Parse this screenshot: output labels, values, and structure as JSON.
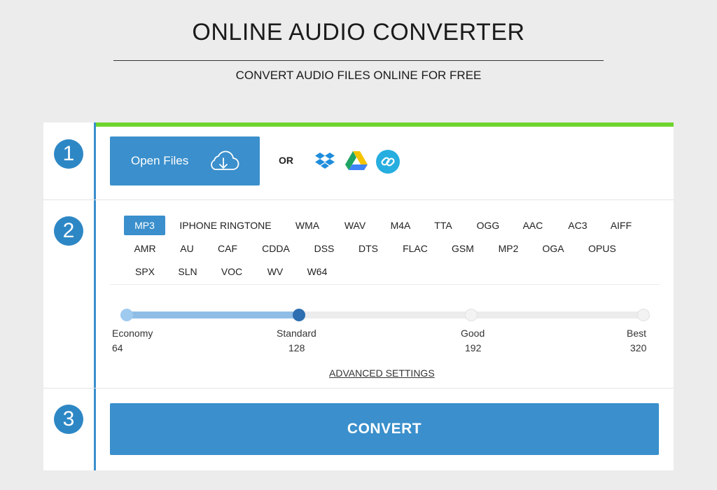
{
  "header": {
    "title": "ONLINE AUDIO CONVERTER",
    "subtitle": "CONVERT AUDIO FILES ONLINE FOR FREE"
  },
  "steps": {
    "one": "1",
    "two": "2",
    "three": "3"
  },
  "upload": {
    "open_files_label": "Open Files",
    "or_label": "OR",
    "services": [
      "dropbox-icon",
      "google-drive-icon",
      "link-icon"
    ]
  },
  "formats": {
    "selected": "MP3",
    "row1": [
      "MP3",
      "IPHONE RINGTONE",
      "WMA",
      "WAV",
      "M4A",
      "TTA",
      "OGG",
      "AAC",
      "AC3",
      "AIFF"
    ],
    "row2": [
      "AMR",
      "AU",
      "CAF",
      "CDDA",
      "DSS",
      "DTS",
      "FLAC",
      "GSM",
      "MP2",
      "OGA",
      "OPUS"
    ],
    "row3": [
      "SPX",
      "SLN",
      "VOC",
      "WV",
      "W64"
    ]
  },
  "quality": {
    "selected_index": 1,
    "levels": [
      {
        "name": "Economy",
        "value": "64"
      },
      {
        "name": "Standard",
        "value": "128"
      },
      {
        "name": "Good",
        "value": "192"
      },
      {
        "name": "Best",
        "value": "320"
      }
    ],
    "advanced_label": "ADVANCED SETTINGS"
  },
  "convert": {
    "label": "CONVERT"
  },
  "colors": {
    "accent": "#3a8fcc",
    "progress": "#6ed42d",
    "step_circle": "#2d87c5"
  }
}
